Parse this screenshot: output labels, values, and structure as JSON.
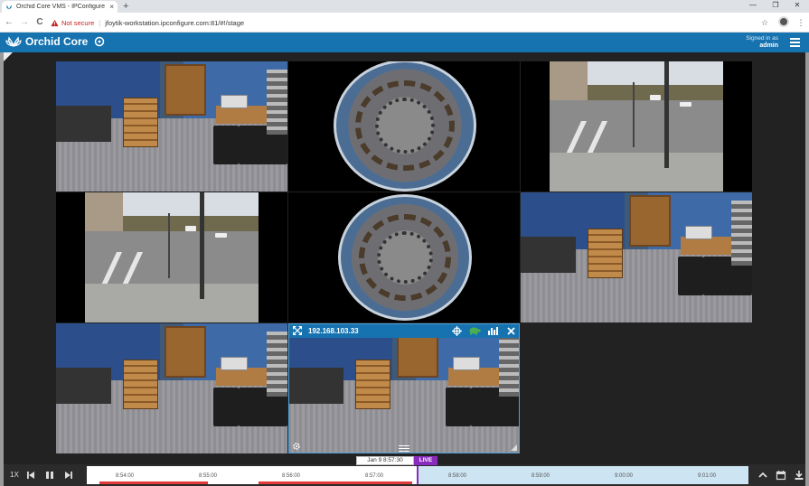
{
  "browser": {
    "tab_title": "Orchid Core VMS - IPConfigure",
    "tab_close": "×",
    "new_tab": "+",
    "security_label": "Not secure",
    "separator": "|",
    "url": "jfoytik-workstation.ipconfigure.com:81/#!/stage",
    "window_minimize": "—",
    "window_restore": "❐",
    "window_close": "✕",
    "back": "←",
    "forward": "→",
    "reload": "C",
    "bookmark": "☆",
    "menu": "⋮"
  },
  "header": {
    "brand": "Orchid Core",
    "signed_in_label": "Signed in as",
    "username": "admin"
  },
  "cameras": {
    "selected_ip": "192.168.103.33"
  },
  "timeline": {
    "speed": "1X",
    "cursor_time": "Jan 9 8:57:30",
    "live_label": "LIVE",
    "ticks": [
      "8:54:00",
      "8:55:00",
      "8:56:00",
      "8:57:00",
      "8:58:00",
      "8:59:00",
      "9:00:00",
      "9:01:00"
    ]
  },
  "colors": {
    "brand_blue": "#1673b0",
    "live_purple": "#8a2bbf",
    "warning_red": "#c5221f"
  }
}
